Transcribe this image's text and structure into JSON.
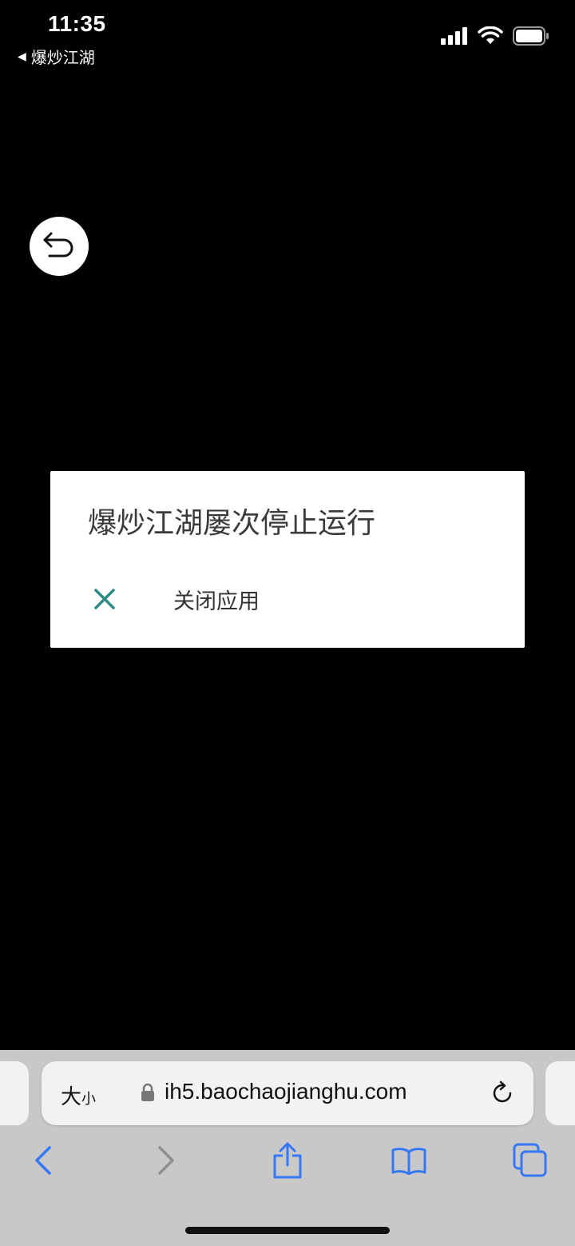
{
  "status_bar": {
    "time": "11:35",
    "back_app_label": "爆炒江湖",
    "icons": [
      "cellular-signal-icon",
      "wifi-icon",
      "battery-icon"
    ]
  },
  "overlay": {
    "back_button_icon": "undo-arrow-icon"
  },
  "dialog": {
    "title": "爆炒江湖屡次停止运行",
    "action_label": "关闭应用",
    "action_icon": "close-icon",
    "accent_color": "#2e8b87"
  },
  "browser": {
    "text_size_label_big": "大",
    "text_size_label_small": "小",
    "url": "ih5.baochaojianghu.com",
    "toolbar_icons": [
      "back-icon",
      "forward-icon",
      "share-icon",
      "bookmarks-icon",
      "tabs-icon"
    ],
    "accent_color": "#3478f6"
  }
}
